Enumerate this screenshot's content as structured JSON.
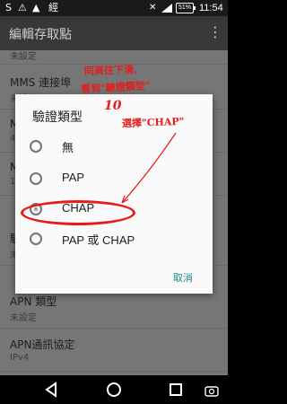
{
  "status_bar": {
    "icons": [
      "s-icon",
      "warning-icon",
      "image-icon",
      "app-icon"
    ],
    "glyphs": [
      "S",
      "⚠",
      "▲",
      "經"
    ],
    "battery": "51%",
    "time": "11:54"
  },
  "toolbar": {
    "title": "編輯存取點",
    "more_icon": "⋮"
  },
  "background_prefs": [
    {
      "title": "",
      "summary": "未設定"
    },
    {
      "title": "MMS 連接埠",
      "summary": "未設定"
    },
    {
      "title": "M",
      "summary": "4"
    },
    {
      "title": "M",
      "summary": "1"
    },
    {
      "title": "驗",
      "summary": "未"
    },
    {
      "title": "APN 類型",
      "summary": "未設定"
    },
    {
      "title": "APN通訊協定",
      "summary": "IPv4"
    }
  ],
  "dialog": {
    "title": "驗證類型",
    "options": [
      {
        "label": "無",
        "checked": false
      },
      {
        "label": "PAP",
        "checked": false
      },
      {
        "label": "CHAP",
        "checked": true
      },
      {
        "label": "PAP 或 CHAP",
        "checked": false
      }
    ],
    "cancel": "取消"
  },
  "annotations": {
    "line1": "同頁往下滑,",
    "line2": "看到\"驗證類型\"",
    "step": "10",
    "select": "選擇\"CHAP\"",
    "color": "#e31d1d"
  },
  "navbar": {
    "icons": [
      "back-icon",
      "home-icon",
      "recents-icon"
    ],
    "corner_icon": "screenshot-icon"
  }
}
